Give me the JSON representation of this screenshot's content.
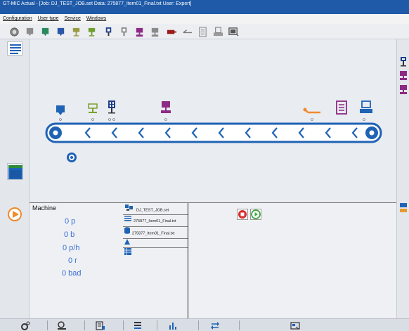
{
  "window": {
    "title": "GT-MIC Actual - [Job: DJ_TEST_JOB.set  Data: 275877_Item01_Final.txt  User: Expert]"
  },
  "menu": {
    "items": [
      "Configuration",
      "User type",
      "Service",
      "Windows"
    ]
  },
  "toolbar": {
    "icons": [
      "home-icon",
      "grey-pump-icon",
      "green-pump-icon",
      "blue-pump-icon",
      "yellow-station-icon",
      "green-station-icon",
      "dark-station-icon",
      "grey-station-icon",
      "purple-station-icon",
      "grey-press-icon",
      "red-sled-icon",
      "lever-icon",
      "stack-icon",
      "printer-icon",
      "monitor-icon"
    ]
  },
  "machine": {
    "title": "Machine",
    "stats": [
      "0  p",
      "0  b",
      "0 p/h",
      "0 r",
      "0 bad"
    ]
  },
  "files": {
    "job": "DJ_TEST_JOB.set",
    "data1": "275877_Item01_Final.txt",
    "data2": "275877_Item01_Final.txt"
  },
  "colors": {
    "conveyor": "#1f63b5",
    "blue": "#1f63b5",
    "green": "#7aa22c",
    "purple": "#8d2a84",
    "orange": "#f08a2c",
    "stop": "#d62d2d",
    "play": "#3ea842"
  }
}
